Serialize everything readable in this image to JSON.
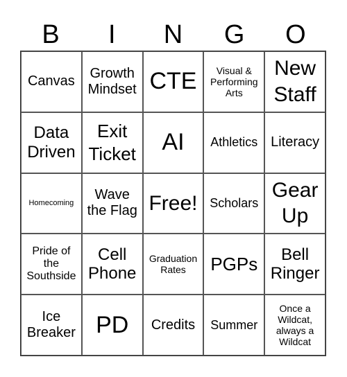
{
  "header": [
    "B",
    "I",
    "N",
    "G",
    "O"
  ],
  "cells": [
    "Canvas",
    "Growth Mindset",
    "CTE",
    "Visual & Performing Arts",
    "New Staff",
    "Data Driven",
    "Exit Ticket",
    "AI",
    "Athletics",
    "Literacy",
    "Homecoming",
    "Wave the Flag",
    "Free!",
    "Scholars",
    "Gear Up",
    "Pride of the Southside",
    "Cell Phone",
    "Graduation Rates",
    "PGPs",
    "Bell Ringer",
    "Ice Breaker",
    "PD",
    "Credits",
    "Summer",
    "Once a Wildcat, always a Wildcat"
  ]
}
